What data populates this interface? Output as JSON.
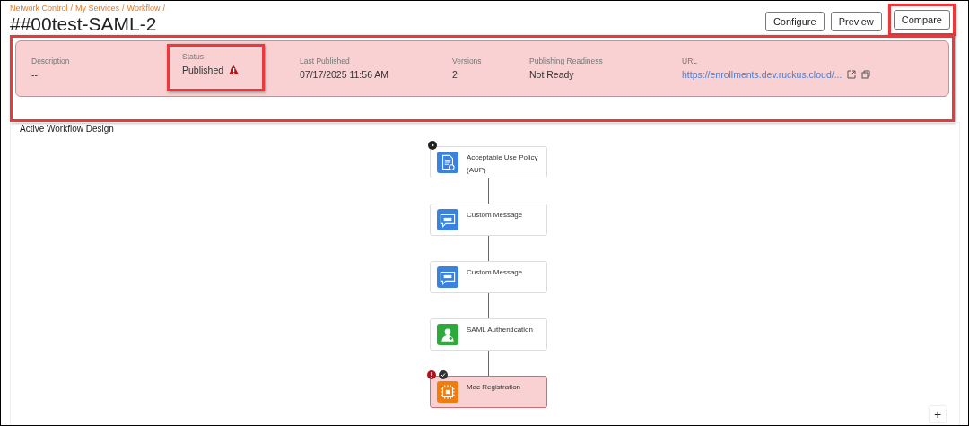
{
  "breadcrumb": [
    {
      "label": "Network Control",
      "separator": "/"
    },
    {
      "label": "My Services",
      "separator": "/"
    },
    {
      "label": "Workflow",
      "separator": "/"
    }
  ],
  "title": "##00test-SAML-2",
  "actions": [
    {
      "label": "Configure",
      "highlighted": false
    },
    {
      "label": "Preview",
      "highlighted": false
    },
    {
      "label": "Compare",
      "highlighted": true
    }
  ],
  "summary": {
    "highlighted": true,
    "fields": [
      {
        "kind": "text",
        "label": "Description",
        "value": "--",
        "highlighted": false
      },
      {
        "kind": "status",
        "label": "Status",
        "value": "Published",
        "warning": true,
        "highlighted": true
      },
      {
        "kind": "text",
        "label": "Last Published",
        "value": "07/17/2025 11:56 AM",
        "highlighted": false
      },
      {
        "kind": "text",
        "label": "Versions",
        "value": "2",
        "highlighted": false
      },
      {
        "kind": "text",
        "label": "Publishing Readiness",
        "value": "Not Ready",
        "highlighted": false
      },
      {
        "kind": "link",
        "label": "URL",
        "value": "https://enrollments.dev.ruckus.cloud/...",
        "highlighted": false
      }
    ]
  },
  "design": {
    "title": "Active Workflow Design",
    "zoom_button": "+",
    "nodes": [
      {
        "kind": "aup",
        "label": "Acceptable Use Policy (AUP)",
        "color": "#3b82e0",
        "start": true,
        "error": false,
        "checked": false
      },
      {
        "kind": "message",
        "label": "Custom Message",
        "color": "#3b82e0",
        "start": false,
        "error": false,
        "checked": false
      },
      {
        "kind": "message",
        "label": "Custom Message",
        "color": "#3b82e0",
        "start": false,
        "error": false,
        "checked": false
      },
      {
        "kind": "saml",
        "label": "SAML Authentication",
        "color": "#2eaa3c",
        "start": false,
        "error": false,
        "checked": false
      },
      {
        "kind": "mac",
        "label": "Mac Registration",
        "color": "#f07c10",
        "start": false,
        "error": true,
        "checked": true
      }
    ]
  }
}
